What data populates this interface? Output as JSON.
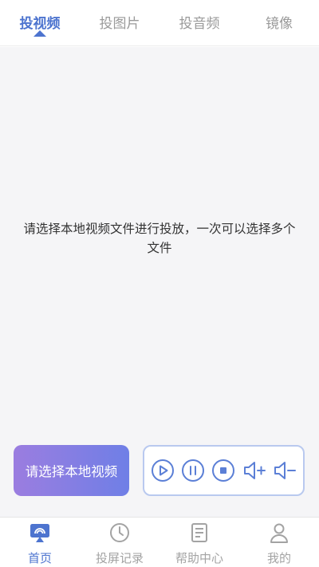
{
  "top_tabs": [
    {
      "label": "投视频",
      "active": true
    },
    {
      "label": "投图片",
      "active": false
    },
    {
      "label": "投音频",
      "active": false
    },
    {
      "label": "镜像",
      "active": false
    }
  ],
  "main": {
    "hint_line1": "请选择本地视频文件进行投放，一次可以选择多个",
    "hint_line2": "文件"
  },
  "controls": {
    "select_label": "请选择本地视频",
    "player_icons": [
      "play-icon",
      "pause-icon",
      "stop-icon",
      "volume-up-icon",
      "volume-down-icon"
    ]
  },
  "bottom_nav": [
    {
      "label": "首页",
      "icon": "cast-icon",
      "active": true
    },
    {
      "label": "投屏记录",
      "icon": "clock-icon",
      "active": false
    },
    {
      "label": "帮助中心",
      "icon": "document-icon",
      "active": false
    },
    {
      "label": "我的",
      "icon": "user-icon",
      "active": false
    }
  ],
  "colors": {
    "accent": "#4d74cf",
    "gradient_start": "#9b7de0",
    "gradient_end": "#6f7fe6",
    "player_border": "#b9c9ef",
    "player_icon": "#5b7fd6"
  }
}
